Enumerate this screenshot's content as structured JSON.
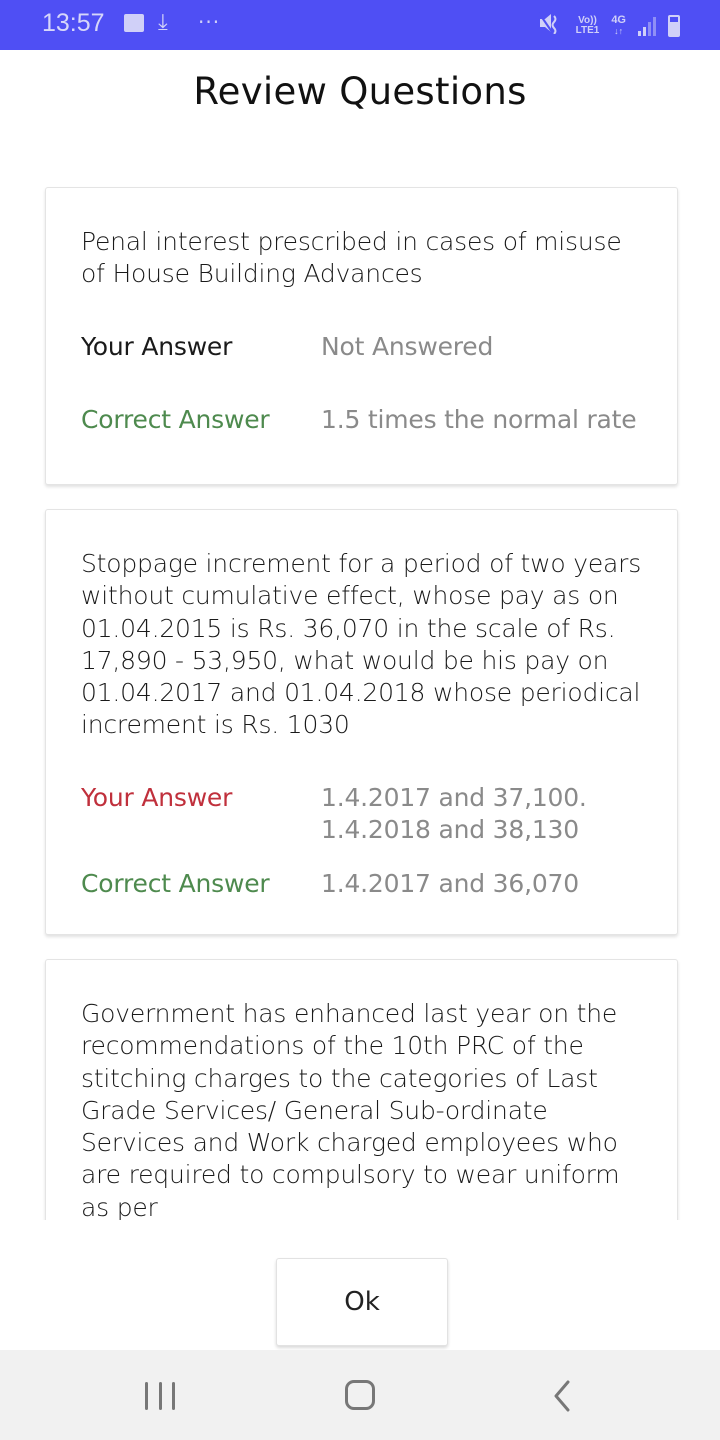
{
  "status_bar": {
    "time": "13:57",
    "left_icons": [
      "gallery-icon",
      "download-icon",
      "more-icon"
    ],
    "more_glyph": "···",
    "download_glyph": "⤓",
    "mute_glyph": "🔇",
    "volte_top": "Vo))",
    "volte_bottom": "LTE1",
    "network_top": "4G",
    "network_bottom": "↓↑",
    "right_icons": [
      "mute-icon",
      "volte-icon",
      "4g-icon",
      "signal-icon",
      "battery-charging-icon"
    ]
  },
  "page": {
    "title": "Review Questions"
  },
  "questions": [
    {
      "text": "Penal interest prescribed in cases of misuse of House Building Advances",
      "your_answer_label": "Your Answer",
      "your_answer": "Not Answered",
      "your_answer_status": "unanswered",
      "correct_answer_label": "Correct Answer",
      "correct_answer": "1.5  times the normal rate"
    },
    {
      "text": "Stoppage increment for a period of two years without cumulative effect, whose pay as on 01.04.2015 is Rs. 36,070 in the scale of Rs. 17,890 - 53,950, what would be his pay on 01.04.2017 and 01.04.2018 whose periodical increment is Rs. 1030",
      "your_answer_label": "Your Answer",
      "your_answer_line1": "1.4.2017 and 37,100.",
      "your_answer_line2": "1.4.2018  and 38,130",
      "your_answer_status": "wrong",
      "correct_answer_label": "Correct Answer",
      "correct_answer": "1.4.2017  and 36,070"
    },
    {
      "text": "Government has enhanced last year on the recommendations of the 10th PRC of the stitching charges to the categories of Last Grade Services/ General Sub-ordinate Services and Work charged employees who are required to compulsory to wear uniform as per"
    }
  ],
  "actions": {
    "ok_label": "Ok"
  },
  "nav_bar": {
    "buttons": [
      "recents",
      "home",
      "back"
    ]
  },
  "colors": {
    "status_bar": "#4f4ff4",
    "wrong": "#c0303c",
    "correct": "#4e8a4e",
    "answer_value": "#8a8a8a",
    "nav_bar": "#f1f1f1"
  }
}
